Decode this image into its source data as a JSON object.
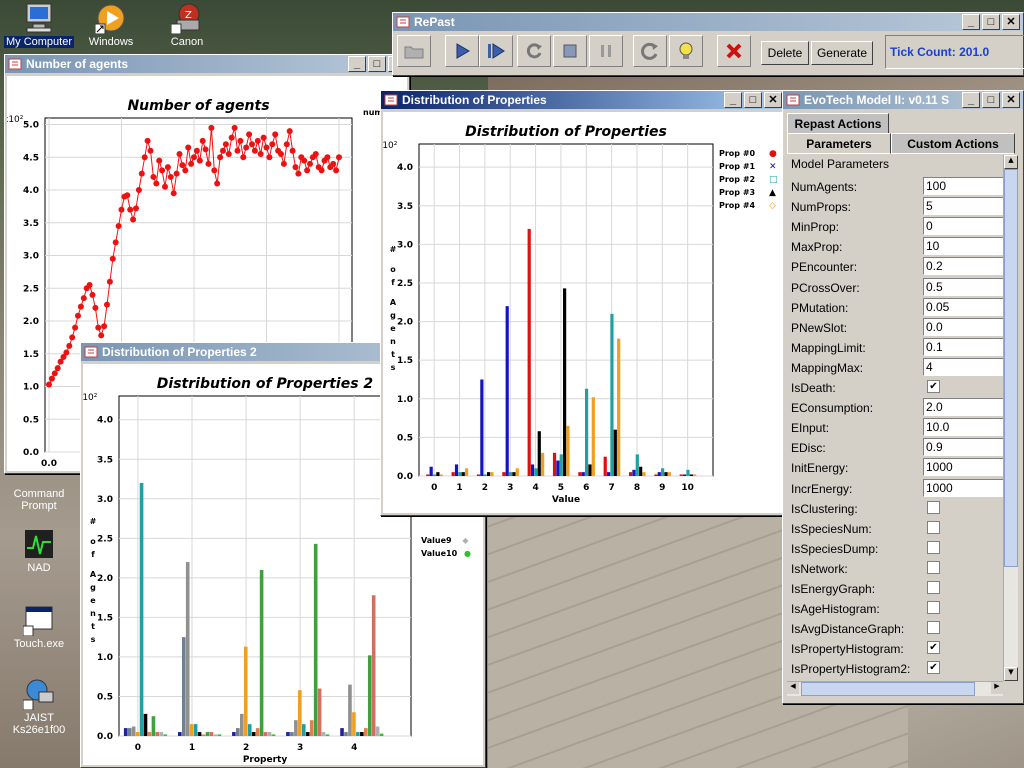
{
  "desktop": {
    "icons": [
      {
        "name": "my-computer",
        "label": "My Computer"
      },
      {
        "name": "windows",
        "label": "Windows"
      },
      {
        "name": "canon",
        "label": "Canon"
      },
      {
        "name": "command-prompt",
        "label": "Command Prompt"
      },
      {
        "name": "nad",
        "label": "NAD"
      },
      {
        "name": "touch-exe",
        "label": "Touch.exe"
      },
      {
        "name": "jaist",
        "label": "JAIST Ks26e1f00"
      }
    ]
  },
  "repast": {
    "title": "RePast",
    "delete_label": "Delete",
    "generate_label": "Generate",
    "tick_count": "Tick Count: 201.0"
  },
  "agents_window": {
    "title": "Number of agents",
    "legend_fragment": "num"
  },
  "dist2_window": {
    "title": "Distribution of Properties 2",
    "legend": [
      "Value9",
      "Value10"
    ]
  },
  "dist_window": {
    "title": "Distribution of Properties"
  },
  "model_window": {
    "title": "EvoTech Model II: v0.11 S",
    "tabs": {
      "repast_actions": "Repast Actions",
      "parameters": "Parameters",
      "custom_actions": "Custom Actions"
    },
    "group_label": "Model Parameters",
    "params": [
      {
        "label": "NumAgents:",
        "value": "100"
      },
      {
        "label": "NumProps:",
        "value": "5"
      },
      {
        "label": "MinProp:",
        "value": "0"
      },
      {
        "label": "MaxProp:",
        "value": "10"
      },
      {
        "label": "PEncounter:",
        "value": "0.2"
      },
      {
        "label": "PCrossOver:",
        "value": "0.5"
      },
      {
        "label": "PMutation:",
        "value": "0.05"
      },
      {
        "label": "PNewSlot:",
        "value": "0.0"
      },
      {
        "label": "MappingLimit:",
        "value": "0.1"
      },
      {
        "label": "MappingMax:",
        "value": "4"
      },
      {
        "label": "IsDeath:",
        "check": true
      },
      {
        "label": "EConsumption:",
        "value": "2.0"
      },
      {
        "label": "EInput:",
        "value": "10.0"
      },
      {
        "label": "EDisc:",
        "value": "0.9"
      },
      {
        "label": "InitEnergy:",
        "value": "1000"
      },
      {
        "label": "IncrEnergy:",
        "value": "1000"
      },
      {
        "label": "IsClustering:",
        "check": false
      },
      {
        "label": "IsSpeciesNum:",
        "check": false
      },
      {
        "label": "IsSpeciesDump:",
        "check": false
      },
      {
        "label": "IsNetwork:",
        "check": false
      },
      {
        "label": "IsEnergyGraph:",
        "check": false
      },
      {
        "label": "IsAgeHistogram:",
        "check": false
      },
      {
        "label": "IsAvgDistanceGraph:",
        "check": false
      },
      {
        "label": "IsPropertyHistogram:",
        "check": true
      },
      {
        "label": "IsPropertyHistogram2:",
        "check": true
      }
    ]
  },
  "colors": {
    "title_active": "#0a246a",
    "title_inactive": "#7a96b4",
    "stop_red": "#cc1111",
    "tick_blue": "#1a3fd1"
  },
  "chart_data": [
    {
      "id": "agents",
      "type": "line",
      "title": "Number of agents",
      "multiplier": "x10²",
      "x": [
        0,
        2,
        4,
        6,
        8,
        10,
        12,
        14,
        16,
        18,
        20,
        22,
        24,
        26,
        28,
        30,
        32,
        34,
        36,
        38,
        40,
        42,
        44,
        46,
        48,
        50,
        52,
        54,
        56,
        58,
        60,
        62,
        64,
        66,
        68,
        70,
        72,
        74,
        76,
        78,
        80,
        82,
        84,
        86,
        88,
        90,
        92,
        94,
        96,
        98,
        100,
        102,
        104,
        106,
        108,
        110,
        112,
        114,
        116,
        118,
        120,
        122,
        124,
        126,
        128,
        130,
        132,
        134,
        136,
        138,
        140,
        142,
        144,
        146,
        148,
        150,
        152,
        154,
        156,
        158,
        160,
        162,
        164,
        166,
        168,
        170,
        172,
        174,
        176,
        178,
        180,
        182,
        184,
        186,
        188,
        190,
        192,
        194,
        196,
        198,
        200
      ],
      "y": [
        1.03,
        1.12,
        1.2,
        1.28,
        1.38,
        1.45,
        1.52,
        1.62,
        1.75,
        1.9,
        2.08,
        2.22,
        2.35,
        2.5,
        2.55,
        2.4,
        2.2,
        1.9,
        1.78,
        1.92,
        2.25,
        2.6,
        2.95,
        3.2,
        3.45,
        3.7,
        3.9,
        3.92,
        3.7,
        3.55,
        3.72,
        4.0,
        4.25,
        4.5,
        4.75,
        4.6,
        4.2,
        4.1,
        4.45,
        4.3,
        4.05,
        4.35,
        4.2,
        3.95,
        4.25,
        4.55,
        4.38,
        4.3,
        4.65,
        4.4,
        4.5,
        4.6,
        4.45,
        4.75,
        4.62,
        4.4,
        4.95,
        4.3,
        4.1,
        4.5,
        4.6,
        4.7,
        4.55,
        4.8,
        4.95,
        4.6,
        4.75,
        4.5,
        4.65,
        4.85,
        4.7,
        4.6,
        4.75,
        4.55,
        4.8,
        4.65,
        4.5,
        4.7,
        4.85,
        4.6,
        4.55,
        4.4,
        4.7,
        4.9,
        4.6,
        4.35,
        4.25,
        4.5,
        4.45,
        4.3,
        4.4,
        4.5,
        4.55,
        4.35,
        4.3,
        4.45,
        4.5,
        4.35,
        4.4,
        4.3,
        4.5
      ],
      "xtick": "0.0",
      "yticks": [
        "0.0",
        "0.5",
        "1.0",
        "1.5",
        "2.0",
        "2.5",
        "3.0",
        "3.5",
        "4.0",
        "4.5",
        "5.0"
      ],
      "ylim": [
        0,
        5.1
      ],
      "series_color": "#ee1111"
    },
    {
      "id": "dist1",
      "type": "bar",
      "title": "Distribution of Properties",
      "multiplier": "x10²",
      "xlabel": "Value",
      "ylabel": "# of Agents",
      "xticks": [
        "0",
        "1",
        "2",
        "3",
        "4",
        "5",
        "6",
        "7",
        "8",
        "9",
        "10"
      ],
      "yticks": [
        "0.0",
        "0.5",
        "1.0",
        "1.5",
        "2.0",
        "2.5",
        "3.0",
        "3.5",
        "4.0"
      ],
      "ylim": [
        0,
        4.3
      ],
      "legend_placement": "right",
      "series": [
        {
          "name": "Prop #0",
          "color": "#e01010",
          "marker": "●",
          "values": [
            0.02,
            0.05,
            0.02,
            0.05,
            3.2,
            0.3,
            0.05,
            0.25,
            0.05,
            0.02,
            0.02
          ]
        },
        {
          "name": "Prop #1",
          "color": "#1515c0",
          "marker": "✕",
          "values": [
            0.12,
            0.15,
            1.25,
            2.2,
            0.15,
            0.2,
            0.05,
            0.05,
            0.08,
            0.05,
            0.02
          ]
        },
        {
          "name": "Prop #2",
          "color": "#20a0a0",
          "marker": "□",
          "values": [
            0.02,
            0.05,
            0.02,
            0.05,
            0.1,
            0.28,
            1.13,
            2.1,
            0.28,
            0.1,
            0.08
          ]
        },
        {
          "name": "Prop #3",
          "color": "#000000",
          "marker": "▲",
          "values": [
            0.05,
            0.05,
            0.05,
            0.05,
            0.58,
            2.43,
            0.15,
            0.6,
            0.12,
            0.05,
            0.02
          ]
        },
        {
          "name": "Prop #4",
          "color": "#f0a020",
          "marker": "◇",
          "values": [
            0.02,
            0.1,
            0.05,
            0.1,
            0.3,
            0.65,
            1.02,
            1.78,
            0.05,
            0.05,
            0.02
          ]
        }
      ]
    },
    {
      "id": "dist2",
      "type": "bar",
      "title": "Distribution of Properties 2",
      "multiplier": "x10²",
      "xlabel": "Property",
      "ylabel": "# of Agents",
      "xticks": [
        "0",
        "1",
        "2",
        "3",
        "4"
      ],
      "yticks": [
        "0.0",
        "0.5",
        "1.0",
        "1.5",
        "2.0",
        "2.5",
        "3.0",
        "3.5",
        "4.0"
      ],
      "ylim": [
        0,
        4.3
      ],
      "palette": [
        "#2020a0",
        "#708090",
        "#909090",
        "#f0a020",
        "#20a0a0",
        "#000000",
        "#e08050",
        "#40a040",
        "#d07060",
        "#b0b0b0",
        "#30c030"
      ],
      "groups": [
        [
          0.1,
          0.1,
          0.12,
          0.05,
          3.2,
          0.28,
          0.05,
          0.25,
          0.05,
          0.05,
          0.02
        ],
        [
          0.05,
          1.25,
          2.2,
          0.15,
          0.15,
          0.05,
          0.02,
          0.05,
          0.05,
          0.02,
          0.02
        ],
        [
          0.05,
          0.1,
          0.28,
          1.13,
          0.15,
          0.05,
          0.1,
          2.1,
          0.05,
          0.05,
          0.02
        ],
        [
          0.05,
          0.05,
          0.2,
          0.58,
          0.15,
          0.05,
          0.2,
          2.43,
          0.6,
          0.05,
          0.02
        ],
        [
          0.1,
          0.05,
          0.65,
          0.3,
          0.05,
          0.05,
          0.1,
          1.02,
          1.78,
          0.12,
          0.03
        ]
      ]
    }
  ]
}
